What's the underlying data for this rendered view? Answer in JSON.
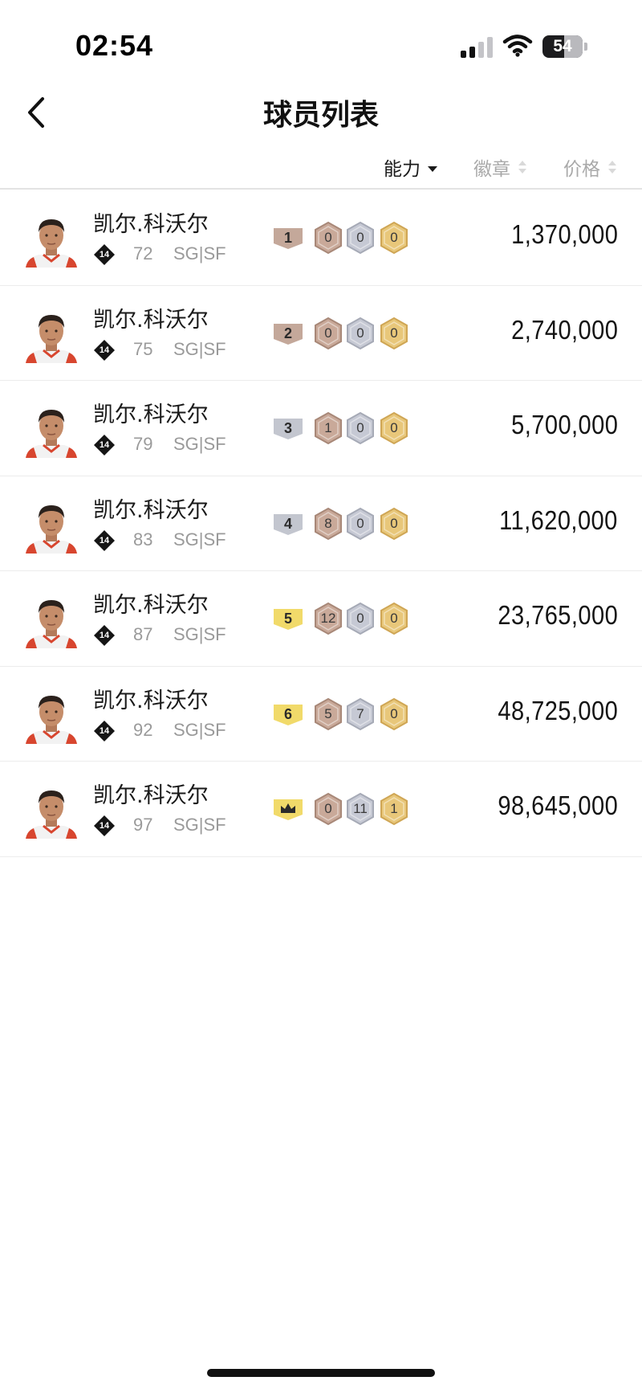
{
  "status_bar": {
    "time": "02:54",
    "battery": "54",
    "battery_level": 0.54,
    "signal_bars_active": 2,
    "signal_bars_total": 4
  },
  "nav": {
    "title": "球员列表",
    "back_icon": "chevron-left-icon"
  },
  "sort": {
    "items": [
      {
        "label": "能力",
        "state": "active-desc"
      },
      {
        "label": "徽章",
        "state": "unsorted"
      },
      {
        "label": "价格",
        "state": "unsorted"
      }
    ]
  },
  "colors": {
    "tier_bronze": "#c4a89a",
    "tier_silver": "#c3c6cf",
    "tier_gold": "#f1da6a",
    "hex_bronze": "#c9a999",
    "hex_silver": "#c6c9d4",
    "hex_gold": "#e8c77a",
    "text_muted": "#9a9a9a"
  },
  "players": [
    {
      "name": "凯尔.科沃尔",
      "number": "14",
      "rating": "72",
      "position": "SG|SF",
      "tier": "1",
      "tier_style": "bronze",
      "badges": [
        "0",
        "0",
        "0"
      ],
      "price": "1,370,000"
    },
    {
      "name": "凯尔.科沃尔",
      "number": "14",
      "rating": "75",
      "position": "SG|SF",
      "tier": "2",
      "tier_style": "bronze",
      "badges": [
        "0",
        "0",
        "0"
      ],
      "price": "2,740,000"
    },
    {
      "name": "凯尔.科沃尔",
      "number": "14",
      "rating": "79",
      "position": "SG|SF",
      "tier": "3",
      "tier_style": "silver",
      "badges": [
        "1",
        "0",
        "0"
      ],
      "price": "5,700,000"
    },
    {
      "name": "凯尔.科沃尔",
      "number": "14",
      "rating": "83",
      "position": "SG|SF",
      "tier": "4",
      "tier_style": "silver",
      "badges": [
        "8",
        "0",
        "0"
      ],
      "price": "11,620,000"
    },
    {
      "name": "凯尔.科沃尔",
      "number": "14",
      "rating": "87",
      "position": "SG|SF",
      "tier": "5",
      "tier_style": "gold",
      "badges": [
        "12",
        "0",
        "0"
      ],
      "price": "23,765,000"
    },
    {
      "name": "凯尔.科沃尔",
      "number": "14",
      "rating": "92",
      "position": "SG|SF",
      "tier": "6",
      "tier_style": "gold",
      "badges": [
        "5",
        "7",
        "0"
      ],
      "price": "48,725,000"
    },
    {
      "name": "凯尔.科沃尔",
      "number": "14",
      "rating": "97",
      "position": "SG|SF",
      "tier": "",
      "tier_style": "crown",
      "badges": [
        "0",
        "11",
        "1"
      ],
      "price": "98,645,000"
    }
  ]
}
